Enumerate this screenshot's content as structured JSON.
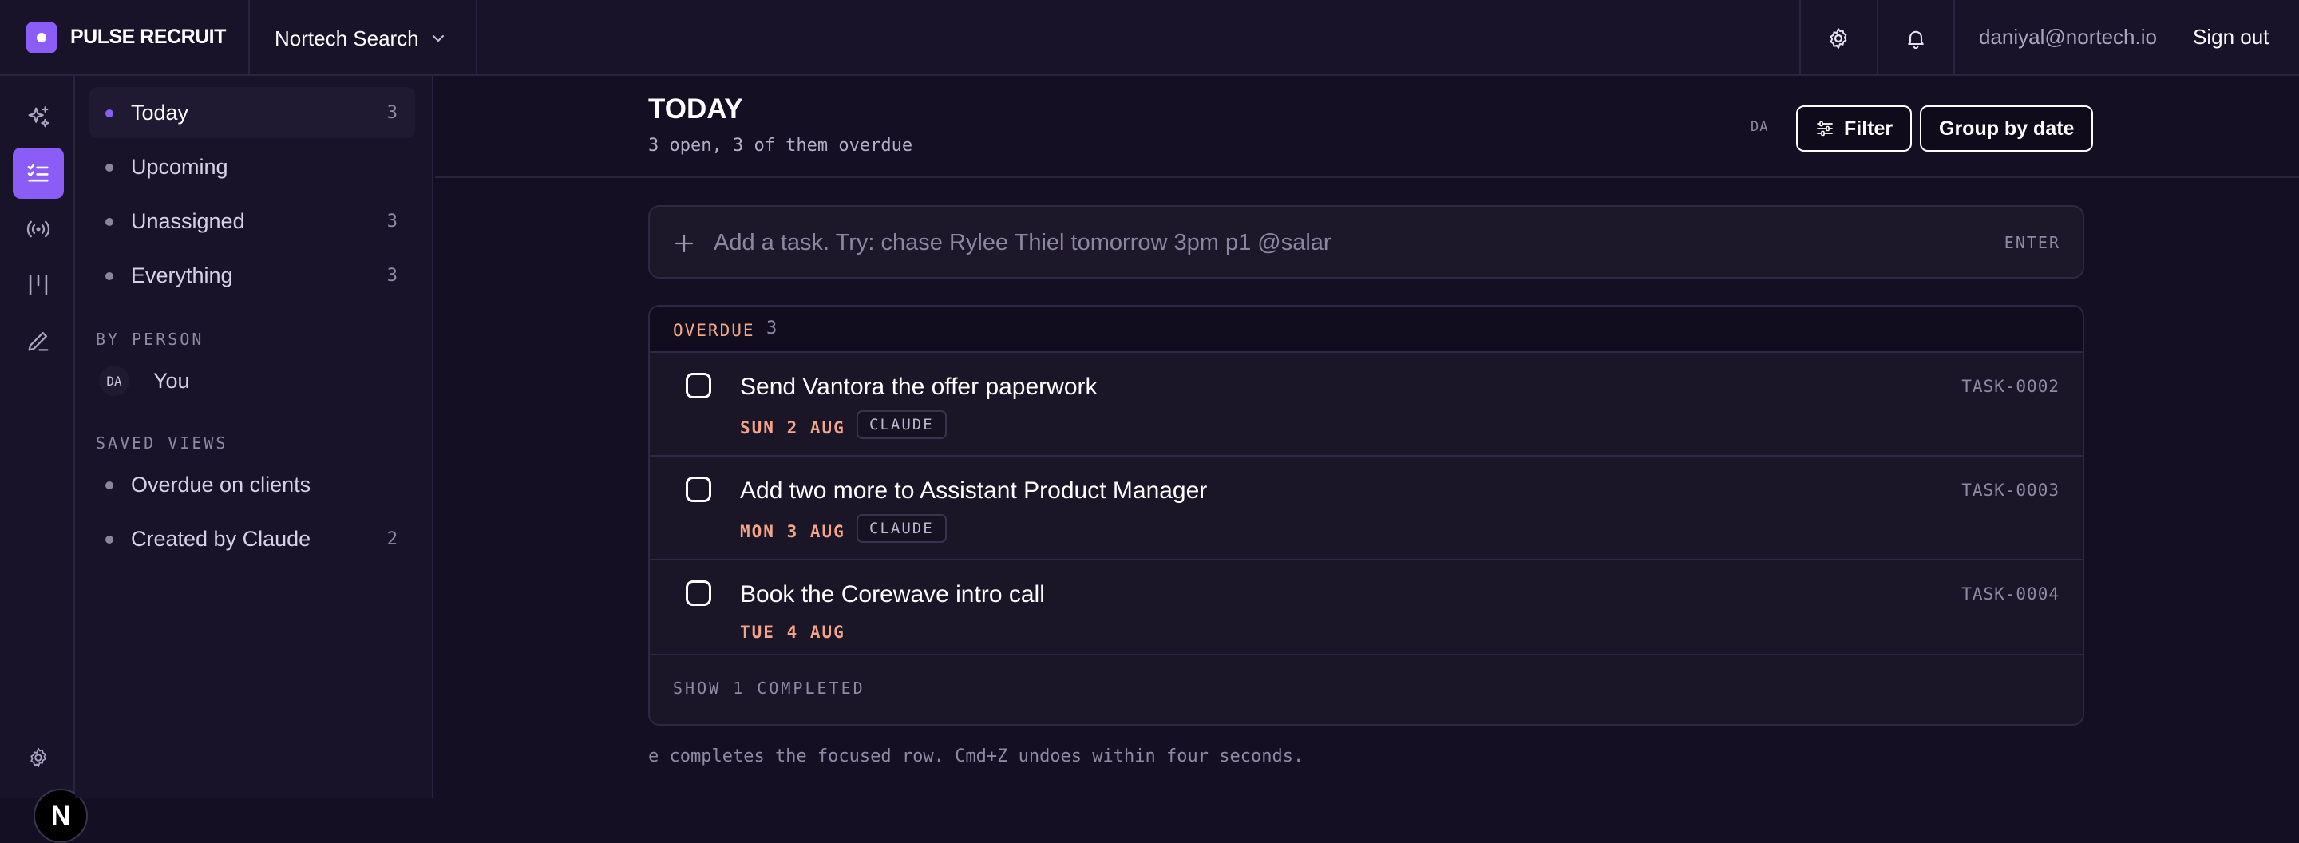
{
  "app": {
    "name": "PULSE RECRUIT",
    "brand_color": "#8b5cf6"
  },
  "topbar": {
    "project": "Nortech Search",
    "user_email": "daniyal@nortech.io",
    "sign_out": "Sign out"
  },
  "rail": {
    "icons": [
      "sparkles-icon",
      "tasks-icon",
      "broadcast-icon",
      "kanban-icon",
      "pen-icon",
      "settings-icon"
    ],
    "active": "tasks-icon",
    "fab_label": "N"
  },
  "sidebar": {
    "items": [
      {
        "label": "Today",
        "count": "3"
      },
      {
        "label": "Upcoming",
        "count": ""
      },
      {
        "label": "Unassigned",
        "count": "3"
      },
      {
        "label": "Everything",
        "count": "3"
      }
    ],
    "by_person_label": "BY PERSON",
    "person": {
      "initials": "DA",
      "name": "You"
    },
    "saved_views_label": "SAVED VIEWS",
    "saved_views": [
      {
        "label": "Overdue on clients",
        "count": ""
      },
      {
        "label": "Created by Claude",
        "count": "2"
      }
    ]
  },
  "header": {
    "title": "TODAY",
    "subtitle": "3 open, 3 of them overdue",
    "avatar_initials": "DA",
    "filter_label": "Filter",
    "group_label": "Group by date"
  },
  "add_task": {
    "placeholder": "Add a task. Try: chase Rylee Thiel tomorrow 3pm p1 @salar",
    "hint": "ENTER"
  },
  "group": {
    "title": "OVERDUE",
    "count": "3",
    "tasks": [
      {
        "title": "Send Vantora the offer paperwork",
        "date": "SUN 2 AUG",
        "tag": "CLAUDE",
        "id": "TASK-0002"
      },
      {
        "title": "Add two more to Assistant Product Manager",
        "date": "MON 3 AUG",
        "tag": "CLAUDE",
        "id": "TASK-0003"
      },
      {
        "title": "Book the Corewave intro call",
        "date": "TUE 4 AUG",
        "tag": "",
        "id": "TASK-0004"
      }
    ],
    "show_completed": "SHOW 1 COMPLETED"
  },
  "footer_hint": "e completes the focused row. Cmd+Z undoes within four seconds."
}
